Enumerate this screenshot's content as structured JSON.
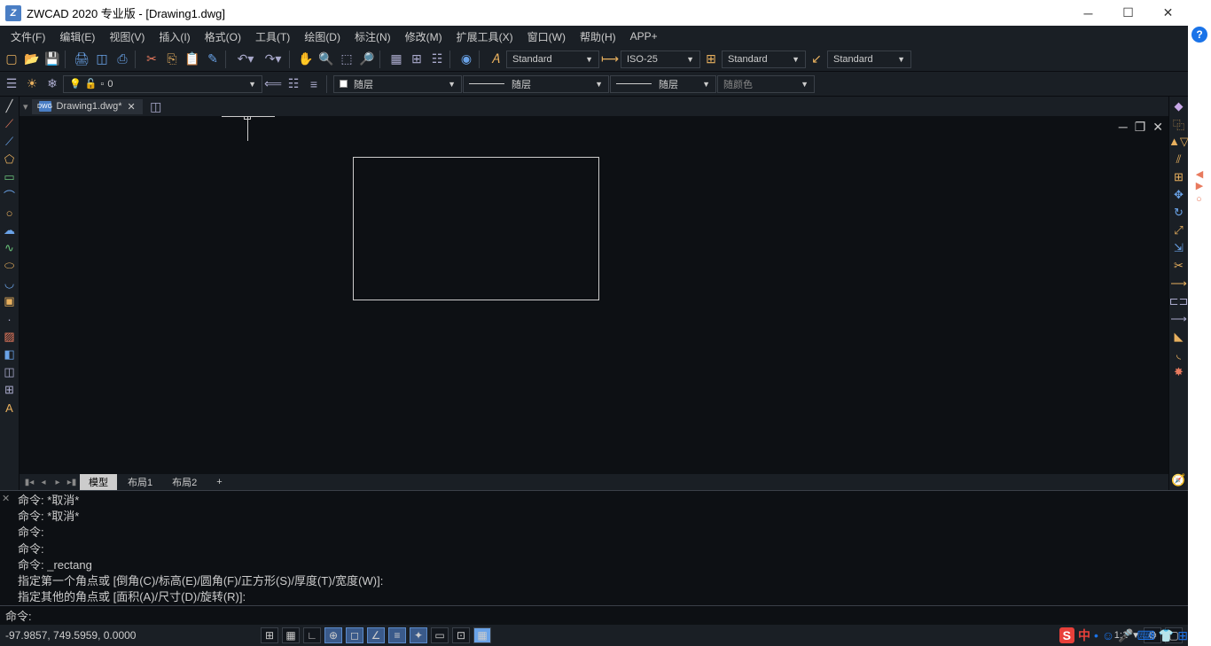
{
  "title": "ZWCAD 2020 专业版 - [Drawing1.dwg]",
  "menus": [
    "文件(F)",
    "编辑(E)",
    "视图(V)",
    "插入(I)",
    "格式(O)",
    "工具(T)",
    "绘图(D)",
    "标注(N)",
    "修改(M)",
    "扩展工具(X)",
    "窗口(W)",
    "帮助(H)",
    "APP+"
  ],
  "styles": {
    "text": "Standard",
    "dim": "ISO-25",
    "table": "Standard",
    "mleader": "Standard"
  },
  "layer": {
    "current": "0"
  },
  "props": {
    "layer": "随层",
    "ltype": "随层",
    "lweight": "随层",
    "color": "随颜色"
  },
  "doctab": "Drawing1.dwg*",
  "layouts": {
    "model": "模型",
    "l1": "布局1",
    "l2": "布局2",
    "add": "+"
  },
  "cmd": {
    "h1": "命令: *取消*",
    "h2": "命令: *取消*",
    "h3": "命令:",
    "h4": "命令:",
    "h5": "命令: _rectang",
    "h6": "指定第一个角点或 [倒角(C)/标高(E)/圆角(F)/正方形(S)/厚度(T)/宽度(W)]:",
    "h7": "指定其他的角点或 [面积(A)/尺寸(D)/旋转(R)]:",
    "prompt": "命令:"
  },
  "coords": "-97.9857, 749.5959, 0.0000",
  "ime": {
    "zhong": "中",
    "dot": "•"
  },
  "ratio": "1:1"
}
